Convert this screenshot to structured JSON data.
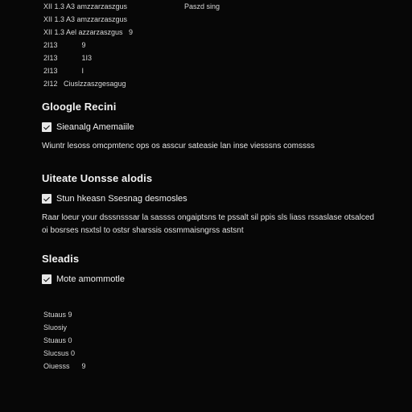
{
  "top_log": {
    "rows": [
      "XII 1.3 A3 amzzarzaszgus",
      "XII 1.3 A3 amzzarzaszgus",
      "XII 1.3 Ael azzarzaszgus   9",
      "2I13            9",
      "2I13            1I3",
      "2I13            I",
      "2I12   Ciuslzzaszgesagug"
    ],
    "right_label": "Paszd sing"
  },
  "sections": [
    {
      "title": "Gloogle Recini",
      "checkbox_label": "Sieanalg Amemaiile",
      "description": "Wiuntr lesoss omcpmtenc ops os asscur sateasie lan inse viesssns comssss"
    },
    {
      "title": "Uiteate Uonsse alodis",
      "checkbox_label": "Stun hkeasn Ssesnag desmosles",
      "description": "Raar loeur your dsssnsssar la sassss ongaiptsns te pssalt sil ppis sls liass rssaslase otsalced oi bosrses nsxtsl to ostsr sharssis ossmmaisngrss astsnt"
    },
    {
      "title": "Sleadis",
      "checkbox_label": "Mote amommotle",
      "description": ""
    }
  ],
  "bottom_log": {
    "rows": [
      "Stuaus 9",
      "Sluosiy",
      "Stuaus 0",
      "Slucsus 0",
      "Oiuesss      9"
    ]
  }
}
